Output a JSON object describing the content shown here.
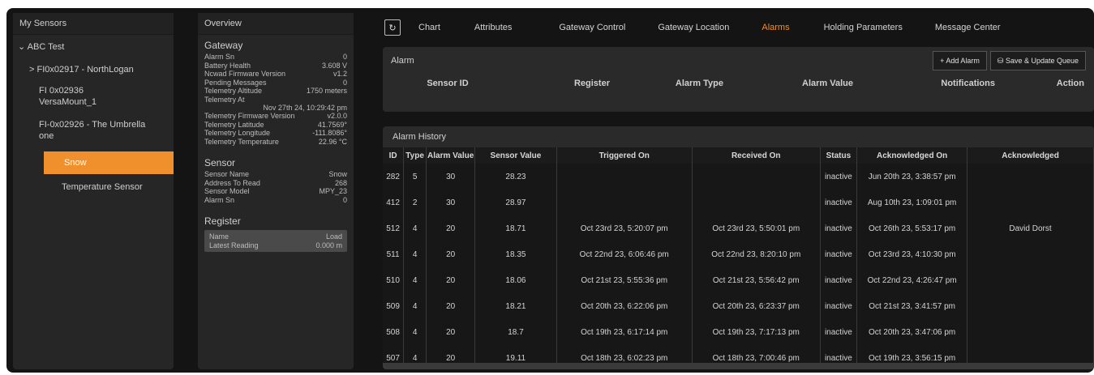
{
  "sidebar": {
    "title": "My Sensors",
    "root": "⌄ ABC Test",
    "items": [
      "> FI0x02917 - NorthLogan",
      "FI 0x02936",
      "VersaMount_1",
      "FI-0x02926 - The Umbrella",
      "one"
    ],
    "selected": "Snow",
    "child": "Temperature Sensor"
  },
  "overview": {
    "title": "Overview",
    "gateway_heading": "Gateway",
    "gateway_rows": [
      {
        "k": "Alarm Sn",
        "v": "0"
      },
      {
        "k": "Battery Health",
        "v": "3.608 V"
      },
      {
        "k": "Ncwad Firmware Version",
        "v": "v1.2"
      },
      {
        "k": "Pending Messages",
        "v": "0"
      },
      {
        "k": "Telemetry Altitude",
        "v": "1750 meters"
      },
      {
        "k": "Telemetry At",
        "v": ""
      }
    ],
    "telemetry_at_value": "Nov 27th 24, 10:29:42 pm",
    "gateway_rows2": [
      {
        "k": "Telemetry Firmware Version",
        "v": "v2.0.0"
      },
      {
        "k": "Telemetry Latitude",
        "v": "41.7569°"
      },
      {
        "k": "Telemetry Longitude",
        "v": "-111.8086°"
      },
      {
        "k": "Telemetry Temperature",
        "v": "22.96 °C"
      }
    ],
    "sensor_heading": "Sensor",
    "sensor_rows": [
      {
        "k": "Sensor Name",
        "v": "Snow"
      },
      {
        "k": "Address To Read",
        "v": "268"
      },
      {
        "k": "Sensor Model",
        "v": "MPY_23"
      },
      {
        "k": "Alarm Sn",
        "v": "0"
      }
    ],
    "register_heading": "Register",
    "register_rows": [
      {
        "k": "Name",
        "v": "Load"
      },
      {
        "k": "Latest Reading",
        "v": "0.000 m"
      }
    ]
  },
  "tabs": {
    "items": [
      "Chart",
      "Attributes",
      "Gateway Control",
      "Gateway Location",
      "Alarms",
      "Holding Parameters",
      "Message Center"
    ],
    "active": "Alarms"
  },
  "alarm": {
    "title": "Alarm",
    "add_button": "+ Add Alarm",
    "save_button": "Save & Update Queue",
    "columns": [
      "Sensor ID",
      "Register",
      "Alarm Type",
      "Alarm Value",
      "Notifications",
      "Action"
    ]
  },
  "history": {
    "title": "Alarm History",
    "columns": [
      "ID",
      "Type",
      "Alarm Value",
      "Sensor Value",
      "Triggered On",
      "Received On",
      "Status",
      "Acknowledged On",
      "Acknowledged"
    ],
    "rows": [
      [
        "282",
        "5",
        "30",
        "28.23",
        "",
        "",
        "inactive",
        "Jun 20th 23, 3:38:57 pm",
        ""
      ],
      [
        "412",
        "2",
        "30",
        "28.97",
        "",
        "",
        "inactive",
        "Aug 10th 23, 1:09:01 pm",
        ""
      ],
      [
        "512",
        "4",
        "20",
        "18.71",
        "Oct 23rd 23, 5:20:07 pm",
        "Oct 23rd 23, 5:50:01 pm",
        "inactive",
        "Oct 26th 23, 5:53:17 pm",
        "David Dorst"
      ],
      [
        "511",
        "4",
        "20",
        "18.35",
        "Oct 22nd 23, 6:06:46 pm",
        "Oct 22nd 23, 8:20:10 pm",
        "inactive",
        "Oct 23rd 23, 4:10:30 pm",
        ""
      ],
      [
        "510",
        "4",
        "20",
        "18.06",
        "Oct 21st 23, 5:55:36 pm",
        "Oct 21st 23, 5:56:42 pm",
        "inactive",
        "Oct 22nd 23, 4:26:47 pm",
        ""
      ],
      [
        "509",
        "4",
        "20",
        "18.21",
        "Oct 20th 23, 6:22:06 pm",
        "Oct 20th 23, 6:23:37 pm",
        "inactive",
        "Oct 21st 23, 3:41:57 pm",
        ""
      ],
      [
        "508",
        "4",
        "20",
        "18.7",
        "Oct 19th 23, 6:17:14 pm",
        "Oct 19th 23, 7:17:13 pm",
        "inactive",
        "Oct 20th 23, 3:47:06 pm",
        ""
      ],
      [
        "507",
        "4",
        "20",
        "19.11",
        "Oct 18th 23, 6:02:23 pm",
        "Oct 18th 23, 7:00:46 pm",
        "inactive",
        "Oct 19th 23, 3:56:15 pm",
        ""
      ]
    ]
  },
  "colors": {
    "accent": "#f0902c",
    "panel": "#262626",
    "background": "#141414"
  }
}
